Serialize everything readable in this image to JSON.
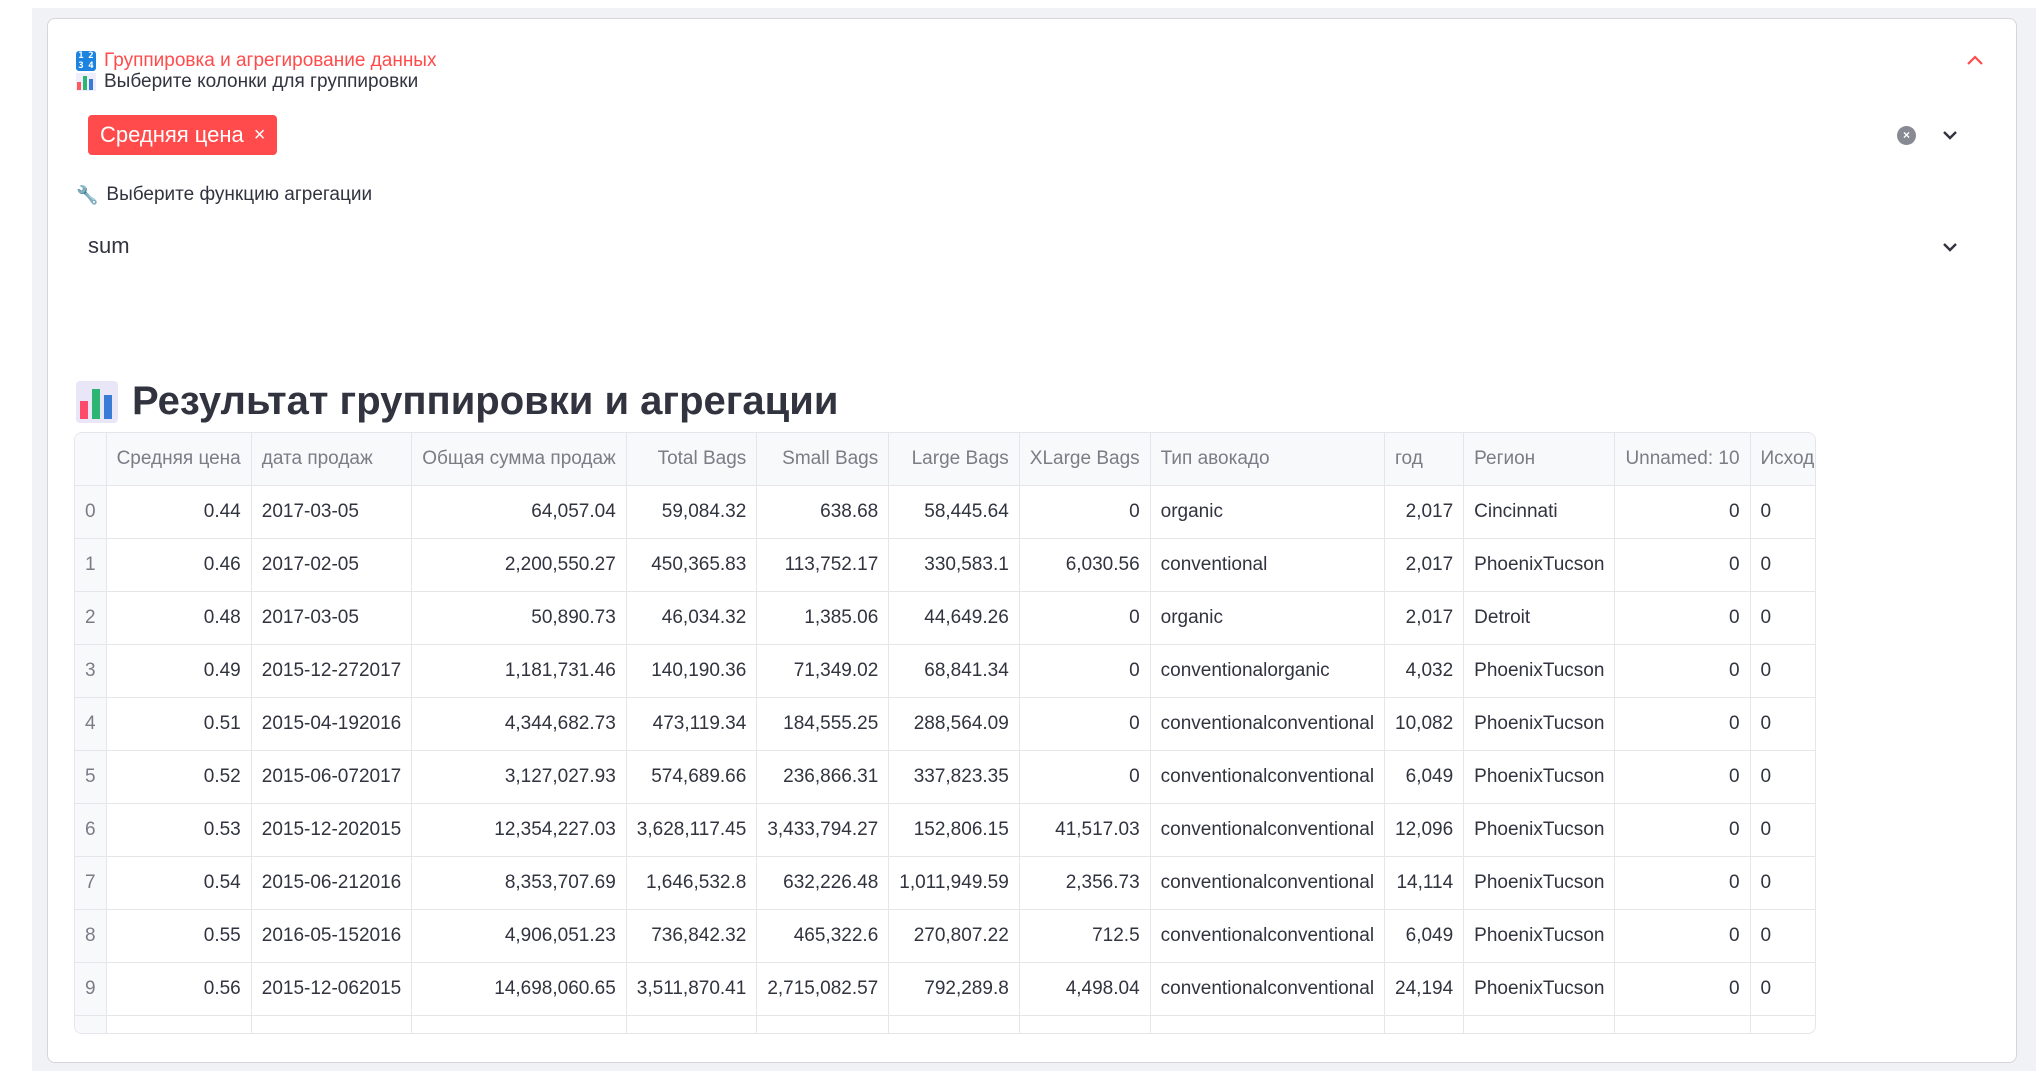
{
  "expander": {
    "title": "Группировка и агрегирование данных",
    "icon_digits": [
      "1",
      "2",
      "3",
      "4"
    ]
  },
  "group_select": {
    "label": "Выберите колонки для группировки",
    "selected_tag": "Средняя цена",
    "tag_remove": "×",
    "clear": "×"
  },
  "agg_select": {
    "label": "Выберите функцию агрегации",
    "value": "sum"
  },
  "result": {
    "heading": "Результат группировки и агрегации"
  },
  "table": {
    "columns": [
      "",
      "Средняя цена",
      "дата  продаж",
      "Общая сумма продаж",
      "Total Bags",
      "Small Bags",
      "Large Bags",
      "XLarge Bags",
      "Тип авокадо",
      "год",
      "Регион",
      "Unnamed: 10",
      "Исходные данные"
    ],
    "rows": [
      [
        "0",
        "0.44",
        "2017-03-05",
        "64,057.04",
        "59,084.32",
        "638.68",
        "58,445.64",
        "0",
        "organic",
        "2,017",
        "Cincinnati",
        "0",
        "0"
      ],
      [
        "1",
        "0.46",
        "2017-02-05",
        "2,200,550.27",
        "450,365.83",
        "113,752.17",
        "330,583.1",
        "6,030.56",
        "conventional",
        "2,017",
        "PhoenixTucson",
        "0",
        "0"
      ],
      [
        "2",
        "0.48",
        "2017-03-05",
        "50,890.73",
        "46,034.32",
        "1,385.06",
        "44,649.26",
        "0",
        "organic",
        "2,017",
        "Detroit",
        "0",
        "0"
      ],
      [
        "3",
        "0.49",
        "2015-12-272017",
        "1,181,731.46",
        "140,190.36",
        "71,349.02",
        "68,841.34",
        "0",
        "conventionalorganic",
        "4,032",
        "PhoenixTucson",
        "0",
        "0"
      ],
      [
        "4",
        "0.51",
        "2015-04-192016",
        "4,344,682.73",
        "473,119.34",
        "184,555.25",
        "288,564.09",
        "0",
        "conventionalconventional",
        "10,082",
        "PhoenixTucson",
        "0",
        "0"
      ],
      [
        "5",
        "0.52",
        "2015-06-072017",
        "3,127,027.93",
        "574,689.66",
        "236,866.31",
        "337,823.35",
        "0",
        "conventionalconventional",
        "6,049",
        "PhoenixTucson",
        "0",
        "0"
      ],
      [
        "6",
        "0.53",
        "2015-12-202015",
        "12,354,227.03",
        "3,628,117.45",
        "3,433,794.27",
        "152,806.15",
        "41,517.03",
        "conventionalconventional",
        "12,096",
        "PhoenixTucson",
        "0",
        "0"
      ],
      [
        "7",
        "0.54",
        "2015-06-212016",
        "8,353,707.69",
        "1,646,532.8",
        "632,226.48",
        "1,011,949.59",
        "2,356.73",
        "conventionalconventional",
        "14,114",
        "PhoenixTucson",
        "0",
        "0"
      ],
      [
        "8",
        "0.55",
        "2016-05-152016",
        "4,906,051.23",
        "736,842.32",
        "465,322.6",
        "270,807.22",
        "712.5",
        "conventionalconventional",
        "6,049",
        "PhoenixTucson",
        "0",
        "0"
      ],
      [
        "9",
        "0.56",
        "2015-12-062015",
        "14,698,060.65",
        "3,511,870.41",
        "2,715,082.57",
        "792,289.8",
        "4,498.04",
        "conventionalconventional",
        "24,194",
        "PhoenixTucson",
        "0",
        "0"
      ]
    ]
  },
  "colors": {
    "accent": "#ff4b4b",
    "text": "#31333f",
    "muted": "#7a7c86",
    "border": "#e6e6ea"
  }
}
